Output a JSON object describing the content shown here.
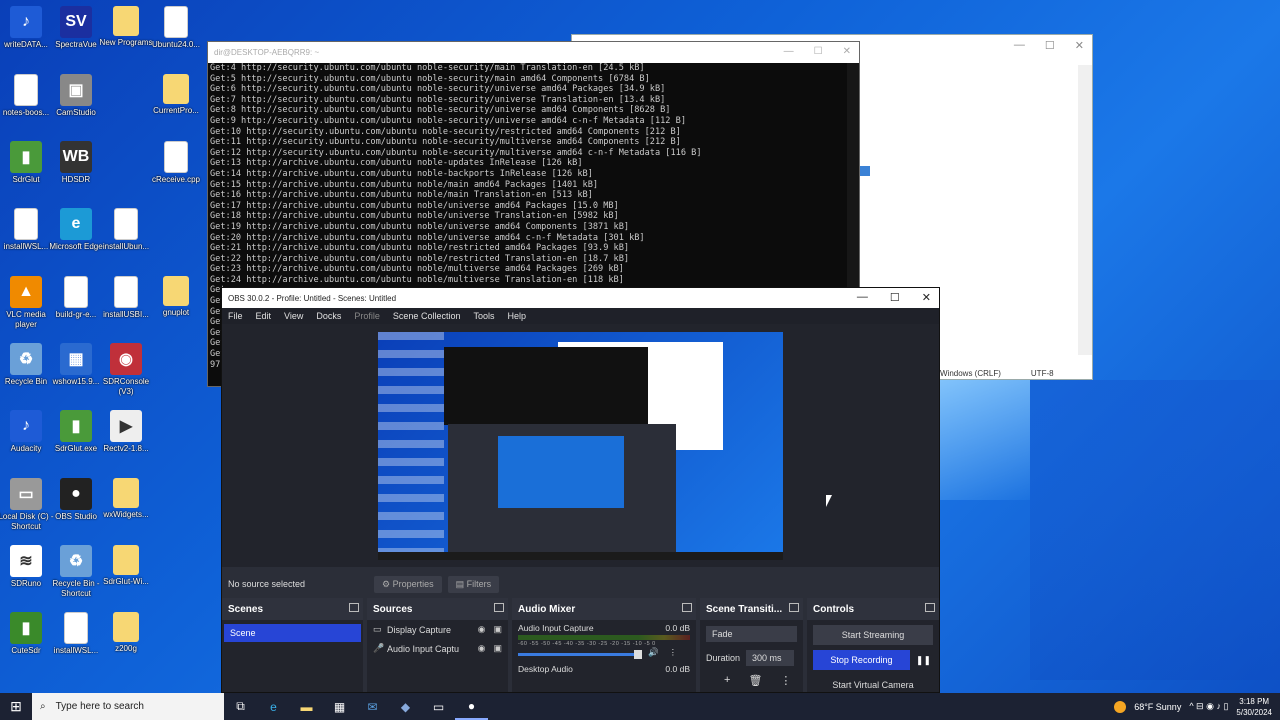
{
  "desktop": {
    "icons": [
      {
        "label": "writeDATA...",
        "glyph": "♪",
        "color": "#1e5bd6"
      },
      {
        "label": "SpectraVue",
        "glyph": "SV",
        "color": "#1b2fa0"
      },
      {
        "label": "New Programs",
        "glyph": "",
        "color": "folder"
      },
      {
        "label": "Ubuntu24.0...",
        "glyph": "",
        "color": "file"
      },
      {
        "label": "notes-boos...",
        "glyph": "",
        "color": "file"
      },
      {
        "label": "CamStudio",
        "glyph": "▣",
        "color": "#888888"
      },
      {
        "label": "CurrentPro...",
        "glyph": "",
        "color": "folder"
      },
      {
        "label": "SdrGlut",
        "glyph": "▮",
        "color": "#4a9a3a"
      },
      {
        "label": "HDSDR",
        "glyph": "WB",
        "color": "#333333"
      },
      {
        "label": "cReceive.cpp",
        "glyph": "+",
        "color": "file"
      },
      {
        "label": "installWSL...",
        "glyph": "",
        "color": "file"
      },
      {
        "label": "Microsoft Edge",
        "glyph": "e",
        "color": "#1c9ad6"
      },
      {
        "label": "installUbun...",
        "glyph": "",
        "color": "file"
      },
      {
        "label": "VLC media player",
        "glyph": "▲",
        "color": "#f08a00"
      },
      {
        "label": "build-gr-e...",
        "glyph": "",
        "color": "file"
      },
      {
        "label": "installUSBI...",
        "glyph": "",
        "color": "file"
      },
      {
        "label": "gnuplot",
        "glyph": "",
        "color": "folder"
      },
      {
        "label": "Recycle Bin",
        "glyph": "♻",
        "color": "#6aa0d8"
      },
      {
        "label": "wshow15.9...",
        "glyph": "▦",
        "color": "#2a6ad0"
      },
      {
        "label": "SDRConsole (V3)",
        "glyph": "◉",
        "color": "#c0303a"
      },
      {
        "label": "Audacity",
        "glyph": "♪",
        "color": "#1e5bd6"
      },
      {
        "label": "SdrGlut.exe",
        "glyph": "▮",
        "color": "#4a9a3a"
      },
      {
        "label": "Rectv2-1.8...",
        "glyph": "▶",
        "color": "#eeeeee"
      },
      {
        "label": "Local Disk (C) - Shortcut",
        "glyph": "▭",
        "color": "#999999"
      },
      {
        "label": "OBS Studio",
        "glyph": "●",
        "color": "#222222"
      },
      {
        "label": "wxWidgets...",
        "glyph": "",
        "color": "folder"
      },
      {
        "label": "SDRuno",
        "glyph": "≋",
        "color": "#ffffff"
      },
      {
        "label": "Recycle Bin - Shortcut",
        "glyph": "♻",
        "color": "#6aa0d8"
      },
      {
        "label": "SdrGlut-Wi...",
        "glyph": "",
        "color": "folder"
      },
      {
        "label": "CuteSdr",
        "glyph": "▮",
        "color": "#3a8a2a"
      },
      {
        "label": "installWSL...",
        "glyph": "",
        "color": "file"
      },
      {
        "label": "z200g",
        "glyph": "",
        "color": "folder"
      }
    ]
  },
  "notepad": {
    "status_eol": "Windows (CRLF)",
    "status_enc": "UTF-8",
    "min": "—",
    "max": "☐",
    "close": "✕"
  },
  "terminal": {
    "title": "dir@DESKTOP-AEBQRR9: ~",
    "lines": [
      "Get:4 http://security.ubuntu.com/ubuntu noble-security/main Translation-en [24.5 kB]",
      "Get:5 http://security.ubuntu.com/ubuntu noble-security/main amd64 Components [6784 B]",
      "Get:6 http://security.ubuntu.com/ubuntu noble-security/universe amd64 Packages [34.9 kB]",
      "Get:7 http://security.ubuntu.com/ubuntu noble-security/universe Translation-en [13.4 kB]",
      "Get:8 http://security.ubuntu.com/ubuntu noble-security/universe amd64 Components [8628 B]",
      "Get:9 http://security.ubuntu.com/ubuntu noble-security/universe amd64 c-n-f Metadata [112 B]",
      "Get:10 http://security.ubuntu.com/ubuntu noble-security/restricted amd64 Components [212 B]",
      "Get:11 http://security.ubuntu.com/ubuntu noble-security/multiverse amd64 Components [212 B]",
      "Get:12 http://security.ubuntu.com/ubuntu noble-security/multiverse amd64 c-n-f Metadata [116 B]",
      "Get:13 http://archive.ubuntu.com/ubuntu noble-updates InRelease [126 kB]",
      "Get:14 http://archive.ubuntu.com/ubuntu noble-backports InRelease [126 kB]",
      "Get:15 http://archive.ubuntu.com/ubuntu noble/main amd64 Packages [1401 kB]",
      "Get:16 http://archive.ubuntu.com/ubuntu noble/main Translation-en [513 kB]",
      "Get:17 http://archive.ubuntu.com/ubuntu noble/universe amd64 Packages [15.0 MB]",
      "Get:18 http://archive.ubuntu.com/ubuntu noble/universe Translation-en [5982 kB]",
      "Get:19 http://archive.ubuntu.com/ubuntu noble/universe amd64 Components [3871 kB]",
      "Get:20 http://archive.ubuntu.com/ubuntu noble/universe amd64 c-n-f Metadata [301 kB]",
      "Get:21 http://archive.ubuntu.com/ubuntu noble/restricted amd64 Packages [93.9 kB]",
      "Get:22 http://archive.ubuntu.com/ubuntu noble/restricted Translation-en [18.7 kB]",
      "Get:23 http://archive.ubuntu.com/ubuntu noble/multiverse amd64 Packages [269 kB]",
      "Get:24 http://archive.ubuntu.com/ubuntu noble/multiverse Translation-en [118 kB]",
      "Get",
      "Get",
      "Get",
      "Get",
      "Get",
      "Get",
      "Get",
      "97:"
    ],
    "min": "—",
    "max": "☐",
    "close": "✕"
  },
  "obs": {
    "title": "OBS 30.0.2 - Profile: Untitled - Scenes: Untitled",
    "min": "—",
    "max": "☐",
    "close": "✕",
    "menu": [
      "File",
      "Edit",
      "View",
      "Docks",
      "Profile",
      "Scene Collection",
      "Tools",
      "Help"
    ],
    "no_source": "No source selected",
    "properties": "⚙ Properties",
    "filters": "▤ Filters",
    "scenes": {
      "title": "Scenes",
      "items": [
        "Scene"
      ]
    },
    "sources": {
      "title": "Sources",
      "items": [
        {
          "icon": "▭",
          "label": "Display Capture"
        },
        {
          "icon": "🎤",
          "label": "Audio Input Captu"
        }
      ]
    },
    "mixer": {
      "title": "Audio Mixer",
      "channels": [
        {
          "name": "Audio Input Capture",
          "db": "0.0 dB",
          "scale": "-60 -55 -50 -45 -40 -35 -30 -25 -20 -15 -10 -5 0"
        },
        {
          "name": "Desktop Audio",
          "db": "0.0 dB"
        }
      ]
    },
    "transitions": {
      "title": "Scene Transiti...",
      "selected": "Fade",
      "duration_label": "Duration",
      "duration": "300 ms"
    },
    "controls": {
      "title": "Controls",
      "start_streaming": "Start Streaming",
      "stop_recording": "Stop Recording",
      "start_virtual_camera": "Start Virtual Camera",
      "pause": "❚❚"
    }
  },
  "taskbar": {
    "search_placeholder": "Type here to search",
    "weather": "68°F Sunny",
    "time": "3:18 PM",
    "date": "5/30/2024",
    "start_glyph": "⊞",
    "search_glyph": "⌕",
    "tray_glyphs": "^ ⊟ ◉ ♪ ▯"
  }
}
